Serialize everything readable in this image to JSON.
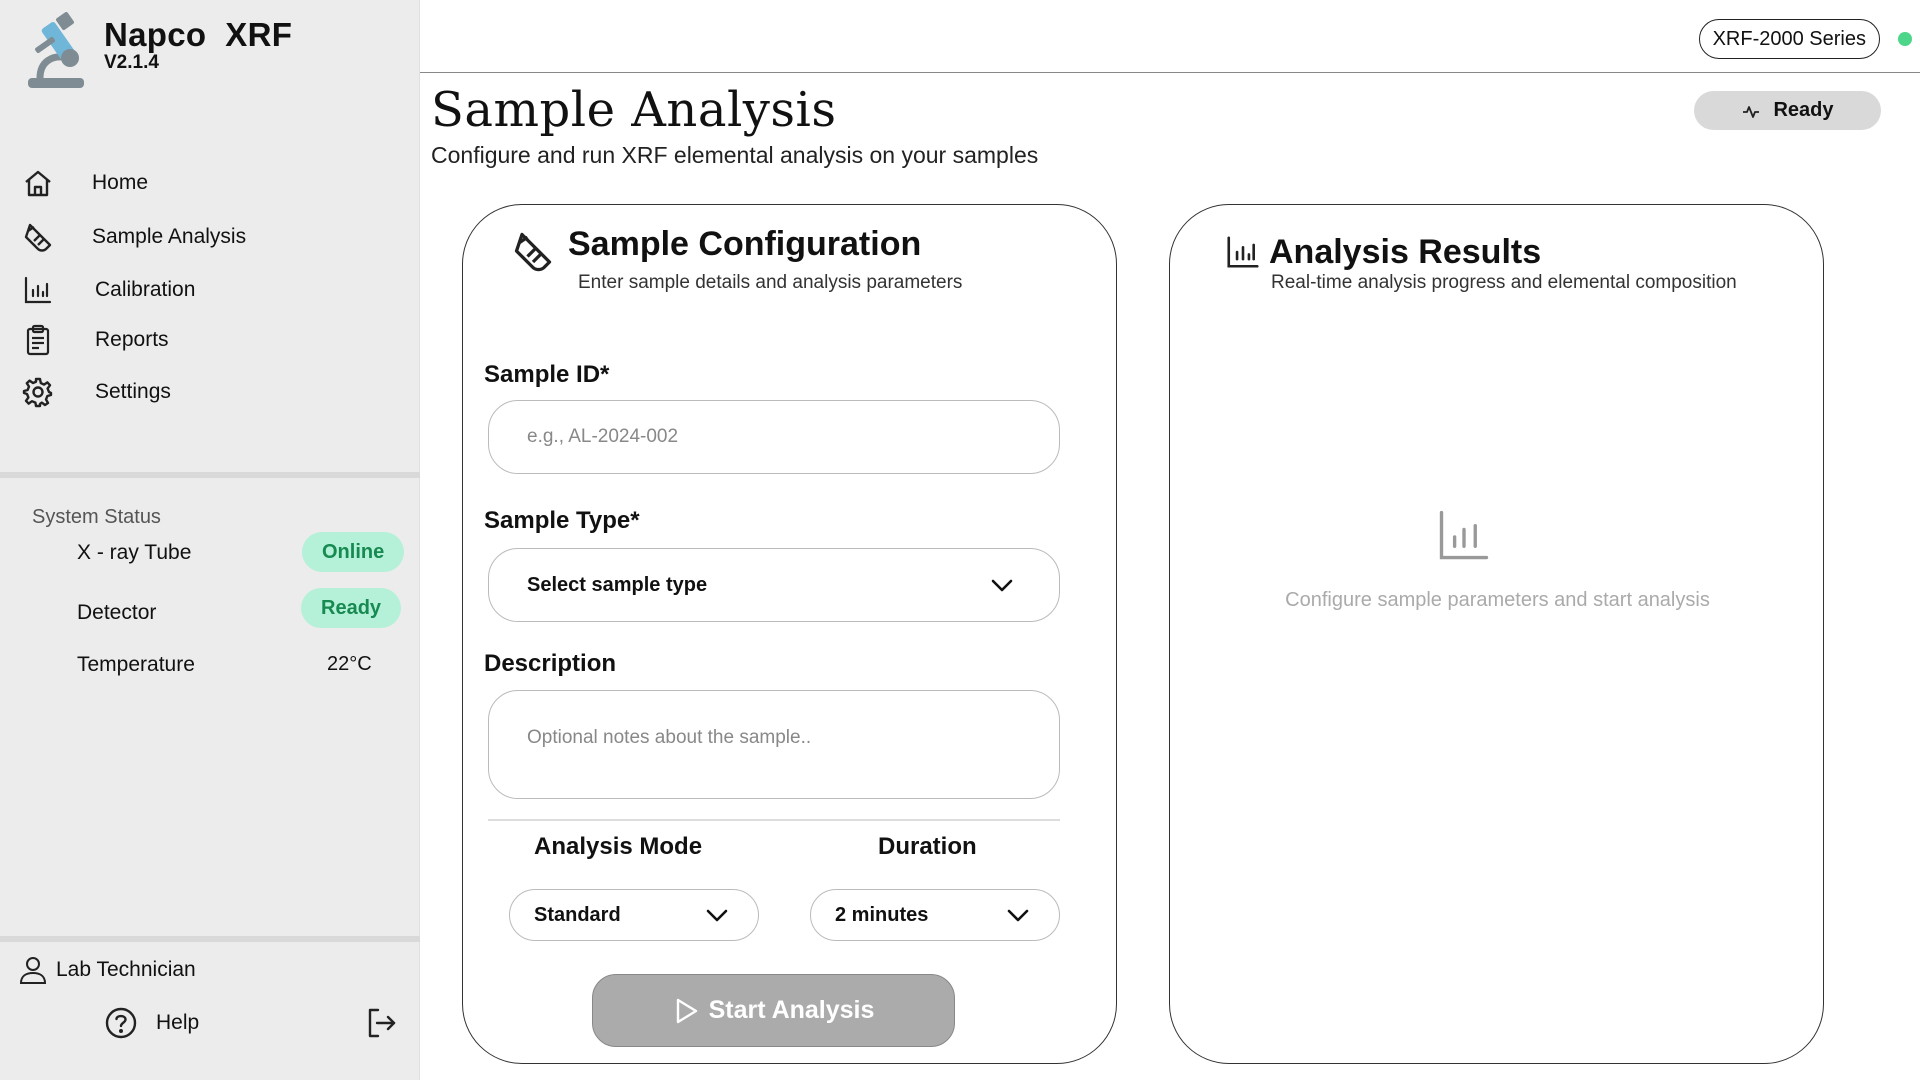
{
  "app": {
    "name": "Napco  XRF",
    "version": "V2.1.4",
    "logo_icon": "microscope-icon"
  },
  "sidebar": {
    "nav": [
      {
        "label": "Home",
        "icon": "home-icon"
      },
      {
        "label": "Sample Analysis",
        "icon": "test-tube-icon"
      },
      {
        "label": "Calibration",
        "icon": "bar-chart-icon"
      },
      {
        "label": "Reports",
        "icon": "clipboard-icon"
      },
      {
        "label": "Settings",
        "icon": "gear-icon"
      }
    ],
    "status": {
      "title": "System Status",
      "items": [
        {
          "label": "X - ray Tube",
          "badge": "Online"
        },
        {
          "label": "Detector",
          "badge": "Ready"
        },
        {
          "label": "Temperature",
          "value": "22°C"
        }
      ]
    },
    "user": {
      "label": "Lab Technician",
      "icon": "user-icon"
    },
    "help": {
      "label": "Help",
      "icon": "help-circle-icon"
    },
    "logout_icon": "logout-icon"
  },
  "topbar": {
    "series": "XRF-2000 Series",
    "indicator_color": "#4cd68a"
  },
  "page": {
    "title": "Sample Analysis",
    "subtitle": "Configure and run XRF elemental analysis on your samples",
    "status_pill": "Ready"
  },
  "config_card": {
    "title": "Sample Configuration",
    "subtitle": "Enter sample details and analysis parameters",
    "sample_id_label": "Sample ID*",
    "sample_id_placeholder": "e.g., AL-2024-002",
    "sample_id_value": "",
    "sample_type_label": "Sample Type*",
    "sample_type_value": "Select sample type",
    "description_label": "Description",
    "description_placeholder": "Optional notes about the sample..",
    "analysis_mode_label": "Analysis Mode",
    "analysis_mode_value": "Standard",
    "duration_label": "Duration",
    "duration_value": "2 minutes",
    "start_label": "Start Analysis"
  },
  "results_card": {
    "title": "Analysis Results",
    "subtitle": "Real-time analysis progress and elemental composition",
    "empty_text": "Configure sample parameters and start analysis"
  },
  "colors": {
    "badge_bg": "#b5f1d9",
    "badge_text": "#178a51",
    "sidebar_bg": "#ececec",
    "start_button_bg": "#ababab"
  }
}
